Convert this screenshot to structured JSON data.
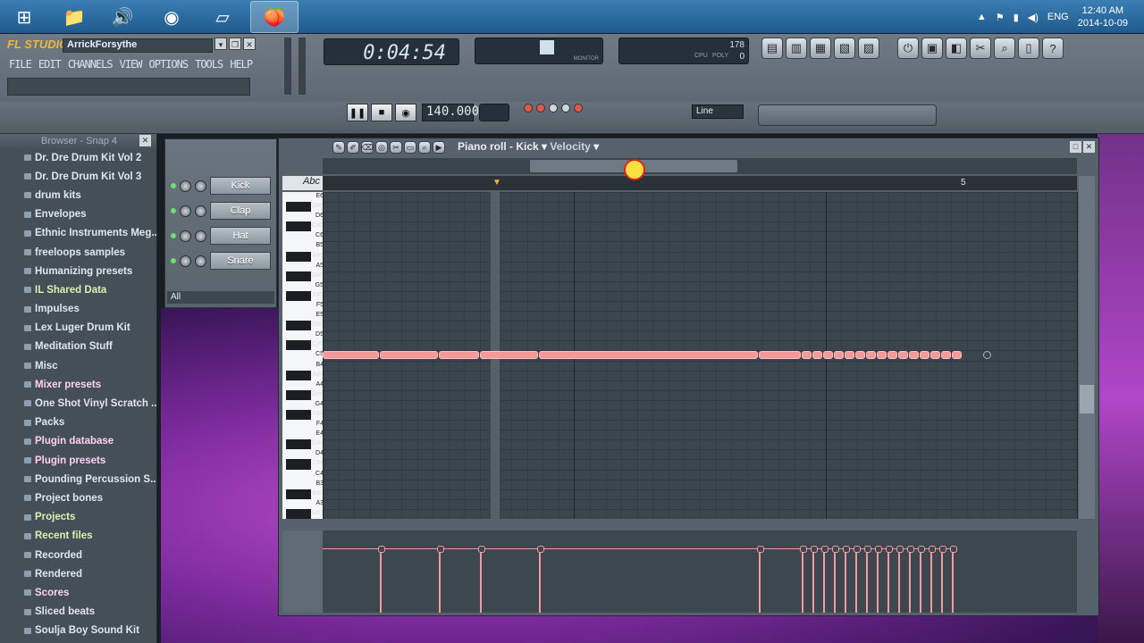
{
  "taskbar": {
    "apps": [
      "windows-start",
      "file-explorer",
      "volume-app",
      "chrome",
      "app-window",
      "fl-studio"
    ],
    "lang": "ENG",
    "time": "12:40 AM",
    "date": "2014-10-09"
  },
  "fl": {
    "logo": "FL STUDIO",
    "user": "ArrickForsythe",
    "menu": [
      "FILE",
      "EDIT",
      "CHANNELS",
      "VIEW",
      "OPTIONS",
      "TOOLS",
      "HELP"
    ],
    "time_display": "0:04:54",
    "tempo": "140.000",
    "snap": "Line",
    "cpu_label": "CPU",
    "poly_label": "POLY",
    "cpu_value": "178",
    "poly_value": "0",
    "monitor_label": "MONITOR"
  },
  "browser": {
    "title": "Browser - Snap 4",
    "items": [
      {
        "label": "Dr. Dre Drum Kit Vol 2",
        "style": ""
      },
      {
        "label": "Dr. Dre Drum Kit Vol 3",
        "style": ""
      },
      {
        "label": "drum kits",
        "style": ""
      },
      {
        "label": "Envelopes",
        "style": ""
      },
      {
        "label": "Ethnic Instruments Meg...",
        "style": ""
      },
      {
        "label": "freeloops samples",
        "style": ""
      },
      {
        "label": "Humanizing presets",
        "style": ""
      },
      {
        "label": "IL Shared Data",
        "style": "gr"
      },
      {
        "label": "Impulses",
        "style": ""
      },
      {
        "label": "Lex Luger Drum Kit",
        "style": ""
      },
      {
        "label": "Meditation Stuff",
        "style": ""
      },
      {
        "label": "Misc",
        "style": ""
      },
      {
        "label": "Mixer presets",
        "style": "hl"
      },
      {
        "label": "One Shot Vinyl Scratch ...",
        "style": ""
      },
      {
        "label": "Packs",
        "style": ""
      },
      {
        "label": "Plugin database",
        "style": "hl"
      },
      {
        "label": "Plugin presets",
        "style": "hl"
      },
      {
        "label": "Pounding Percussion S...",
        "style": ""
      },
      {
        "label": "Project bones",
        "style": ""
      },
      {
        "label": "Projects",
        "style": "gr"
      },
      {
        "label": "Recent files",
        "style": "gr"
      },
      {
        "label": "Recorded",
        "style": ""
      },
      {
        "label": "Rendered",
        "style": ""
      },
      {
        "label": "Scores",
        "style": "hl"
      },
      {
        "label": "Sliced beats",
        "style": ""
      },
      {
        "label": "Soulja Boy Sound Kit",
        "style": ""
      }
    ]
  },
  "rack": {
    "channels": [
      "Kick",
      "Clap",
      "Hat",
      "Snare"
    ],
    "filter": "All"
  },
  "piano_roll": {
    "title": "Piano roll - Kick",
    "target": "Velocity",
    "abc": "Abc",
    "bar_marker": "5",
    "key_labels": [
      "E6",
      "D#6",
      "D6",
      "C#6",
      "C6",
      "B5",
      "A#5",
      "A5",
      "G#5",
      "G5",
      "F#5",
      "F5",
      "E5",
      "D#5",
      "D5",
      "C#5",
      "C5",
      "B4",
      "A#4",
      "A4",
      "G#4",
      "G4",
      "F#4",
      "F4",
      "E4",
      "D#4",
      "D4",
      "C#4",
      "C4",
      "B3",
      "A#3",
      "A3",
      "G#3"
    ],
    "note_row": "C5"
  }
}
